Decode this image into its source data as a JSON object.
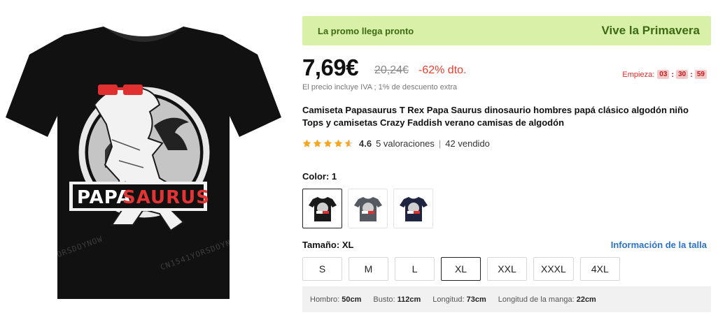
{
  "product_image": {
    "shirt_color": "#111111",
    "print_text_dark": "PAPA",
    "print_text_red": "SAURUS",
    "watermark": "CN1541YORSDOYNOW"
  },
  "promo": {
    "left_text": "La promo llega pronto",
    "right_text": "Vive la Primavera",
    "bg_color": "#d8f0a8",
    "text_color": "#3d6a12"
  },
  "price": {
    "current": "7,69€",
    "original": "20,24€",
    "discount": "-62% dto."
  },
  "countdown": {
    "label": "Empieza:",
    "hours": "03",
    "minutes": "30",
    "seconds": "59",
    "separator": ":"
  },
  "tax_note": "El precio incluye IVA ; 1% de descuento extra",
  "title": "Camiseta Papasaurus T Rex Papa Saurus dinosaurio hombres papá clásico algodón niño Tops y camisetas Crazy Faddish verano camisas de algodón",
  "rating": {
    "stars_icon": "star-icon",
    "value": "4.6",
    "reviews": "5 valoraciones",
    "divider": "|",
    "sold": "42 vendido",
    "star_color": "#f5a623"
  },
  "color": {
    "label": "Color: 1",
    "swatches": [
      {
        "name": "black",
        "color": "#1a1a1a",
        "selected": true
      },
      {
        "name": "gray",
        "color": "#555a62",
        "selected": false
      },
      {
        "name": "navy",
        "color": "#1f2440",
        "selected": false
      }
    ]
  },
  "size": {
    "label": "Tamaño: XL",
    "guide_link": "Información de la talla",
    "options": [
      "S",
      "M",
      "L",
      "XL",
      "XXL",
      "XXXL",
      "4XL"
    ],
    "selected": "XL"
  },
  "measurements": [
    {
      "label": "Hombro:",
      "value": "50cm"
    },
    {
      "label": "Busto:",
      "value": "112cm"
    },
    {
      "label": "Longitud:",
      "value": "73cm"
    },
    {
      "label": "Longitud de la manga:",
      "value": "22cm"
    }
  ]
}
